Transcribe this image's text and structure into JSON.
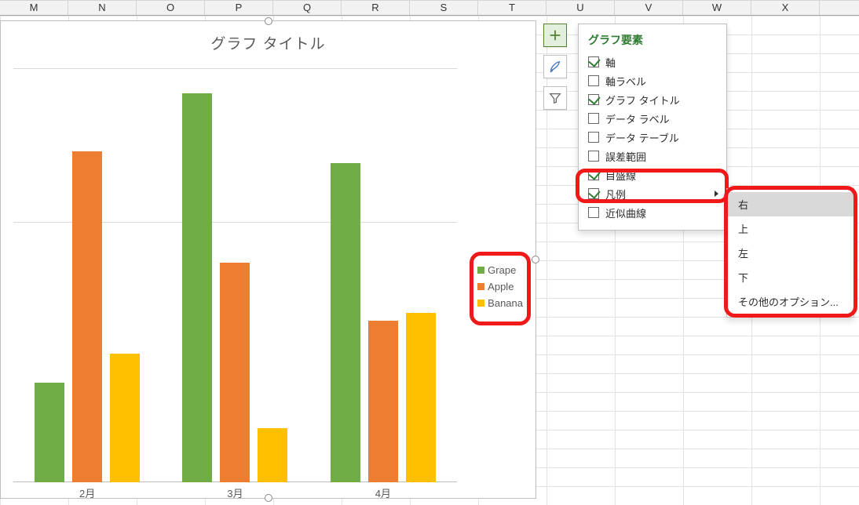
{
  "columns": [
    "M",
    "N",
    "O",
    "P",
    "Q",
    "R",
    "S",
    "T",
    "U",
    "V",
    "W",
    "X"
  ],
  "chart_title": "グラフ タイトル",
  "legend": {
    "grape": "Grape",
    "apple": "Apple",
    "banana": "Banana"
  },
  "chart_data": {
    "type": "bar",
    "title": "グラフ タイトル",
    "categories": [
      "2月",
      "3月",
      "4月"
    ],
    "series": [
      {
        "name": "Grape",
        "color": "#70ad47",
        "values": [
          24,
          94,
          77
        ]
      },
      {
        "name": "Apple",
        "color": "#ed7d31",
        "values": [
          80,
          53,
          39
        ]
      },
      {
        "name": "Banana",
        "color": "#ffc000",
        "values": [
          31,
          13,
          41
        ]
      }
    ],
    "ylim": [
      0,
      100
    ],
    "legend_position": "right",
    "gridlines": "horizontal"
  },
  "side_tools": {
    "plus": "chart-elements-button",
    "brush": "chart-styles-button",
    "filter": "chart-filters-button"
  },
  "flyout": {
    "title": "グラフ要素",
    "items": [
      {
        "label": "軸",
        "checked": true
      },
      {
        "label": "軸ラベル",
        "checked": false
      },
      {
        "label": "グラフ タイトル",
        "checked": true
      },
      {
        "label": "データ ラベル",
        "checked": false
      },
      {
        "label": "データ テーブル",
        "checked": false
      },
      {
        "label": "誤差範囲",
        "checked": false
      },
      {
        "label": "目盛線",
        "checked": true
      },
      {
        "label": "凡例",
        "checked": true,
        "submenu": true
      },
      {
        "label": "近似曲線",
        "checked": false
      }
    ]
  },
  "submenu": {
    "items": [
      "右",
      "上",
      "左",
      "下",
      "その他のオプション..."
    ],
    "hover_index": 0
  }
}
